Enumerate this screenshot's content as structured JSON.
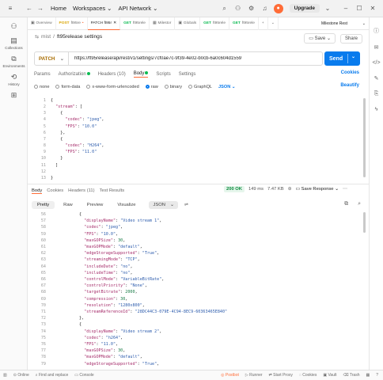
{
  "titlebar": {
    "home": "Home",
    "workspaces": "Workspaces",
    "api_network": "API Network",
    "upgrade": "Upgrade"
  },
  "rail": [
    {
      "icon": "person-icon",
      "glyph": "⚇",
      "label": ""
    },
    {
      "icon": "collections-icon",
      "glyph": "▤",
      "label": "Collections"
    },
    {
      "icon": "environments-icon",
      "glyph": "⧉",
      "label": "Environments"
    },
    {
      "icon": "history-icon",
      "glyph": "⟲",
      "label": "History"
    },
    {
      "icon": "grid-icon",
      "glyph": "⊞",
      "label": ""
    }
  ],
  "tabs": [
    {
      "label": "Overview",
      "method": ""
    },
    {
      "label": "ft95re",
      "method": "POST"
    },
    {
      "label": "PATCH ft95r",
      "method": ""
    },
    {
      "label": "ft95rele",
      "method": "GET"
    },
    {
      "label": "Milestor",
      "method": ""
    },
    {
      "label": "Globals",
      "method": ""
    },
    {
      "label": "ft95rele",
      "method": "GET"
    },
    {
      "label": "ft95rele",
      "method": "GET"
    }
  ],
  "environment": "Milestone Rest",
  "request": {
    "collection": "mist",
    "name": "ft95release settings",
    "save": "Save",
    "share": "Share",
    "method": "PATCH",
    "url": "https://ft95release/api/rest/v1/settings/7cf0ae7c-9f39-4e02-b0cb-6a0c604d1559",
    "send": "Send"
  },
  "request_tabs": [
    "Params",
    "Authorization",
    "Headers (10)",
    "Body",
    "Scripts",
    "Settings"
  ],
  "cookies": "Cookies",
  "body_options": [
    "none",
    "form-data",
    "x-www-form-urlencoded",
    "raw",
    "binary",
    "GraphQL"
  ],
  "body_format": "JSON",
  "beautify": "Beautify",
  "request_body": {
    "line_numbers": [
      "1",
      "2",
      "3",
      "4",
      "5",
      "6",
      "7",
      "8",
      "9",
      "10",
      "11",
      "12",
      "13"
    ],
    "lines": [
      "{",
      "  \"stream\": [",
      "    {",
      "      \"codec\": \"jpeg\",",
      "      \"FPS\": \"10.0\"",
      "    },",
      "    {",
      "      \"codec\": \"H264\",",
      "      \"FPS\": \"11.0\"",
      "    }",
      "  ]",
      "",
      "}"
    ]
  },
  "response_tabs": [
    "Body",
    "Cookies",
    "Headers (11)",
    "Test Results"
  ],
  "response_status": {
    "code": "200 OK",
    "time": "149 ms",
    "size": "7.47 KB",
    "save": "Save Response"
  },
  "response_view": [
    "Pretty",
    "Raw",
    "Preview",
    "Visualize"
  ],
  "response_format": "JSON",
  "response_body": {
    "line_numbers": [
      "56",
      "57",
      "58",
      "59",
      "60",
      "61",
      "62",
      "63",
      "64",
      "65",
      "66",
      "67",
      "68",
      "69",
      "70",
      "71",
      "72",
      "73",
      "74",
      "75",
      "76",
      "77",
      "78",
      "79"
    ],
    "lines": [
      "{",
      "  \"displayName\": \"Video stream 1\",",
      "  \"codec\": \"jpeg\",",
      "  \"FPS\": \"10.0\",",
      "  \"maxGOPSize\": 30,",
      "  \"maxGOPMode\": \"default\",",
      "  \"edgeStorageSupported\": \"True\",",
      "  \"streamingMode\": \"TCP\",",
      "  \"includeDate\": \"no\",",
      "  \"includeTime\": \"no\",",
      "  \"controlMode\": \"VariableBitRate\",",
      "  \"controlPriority\": \"None\",",
      "  \"targetBitrate\": 2000,",
      "  \"compression\": 30,",
      "  \"resolution\": \"1280x800\",",
      "  \"streamReferenceId\": \"28DC44C3-079E-4C94-8EC9-60363465E840\"",
      "},",
      "{",
      "  \"displayName\": \"Video stream 2\",",
      "  \"codec\": \"h264\",",
      "  \"FPS\": \"11.0\",",
      "  \"maxGOPSize\": 30,",
      "  \"maxGOPMode\": \"default\",",
      "  \"edgeStorageSupported\": \"True\","
    ]
  },
  "footer": {
    "left": [
      "Online",
      "Find and replace",
      "Console"
    ],
    "right": [
      "Postbot",
      "Runner",
      "Start Proxy",
      "Cookies",
      "Vault",
      "Trash"
    ]
  },
  "colors": {
    "accent": "#ff6c37",
    "send": "#097bed",
    "patch": "#a86c00",
    "get": "#0cbb52"
  }
}
